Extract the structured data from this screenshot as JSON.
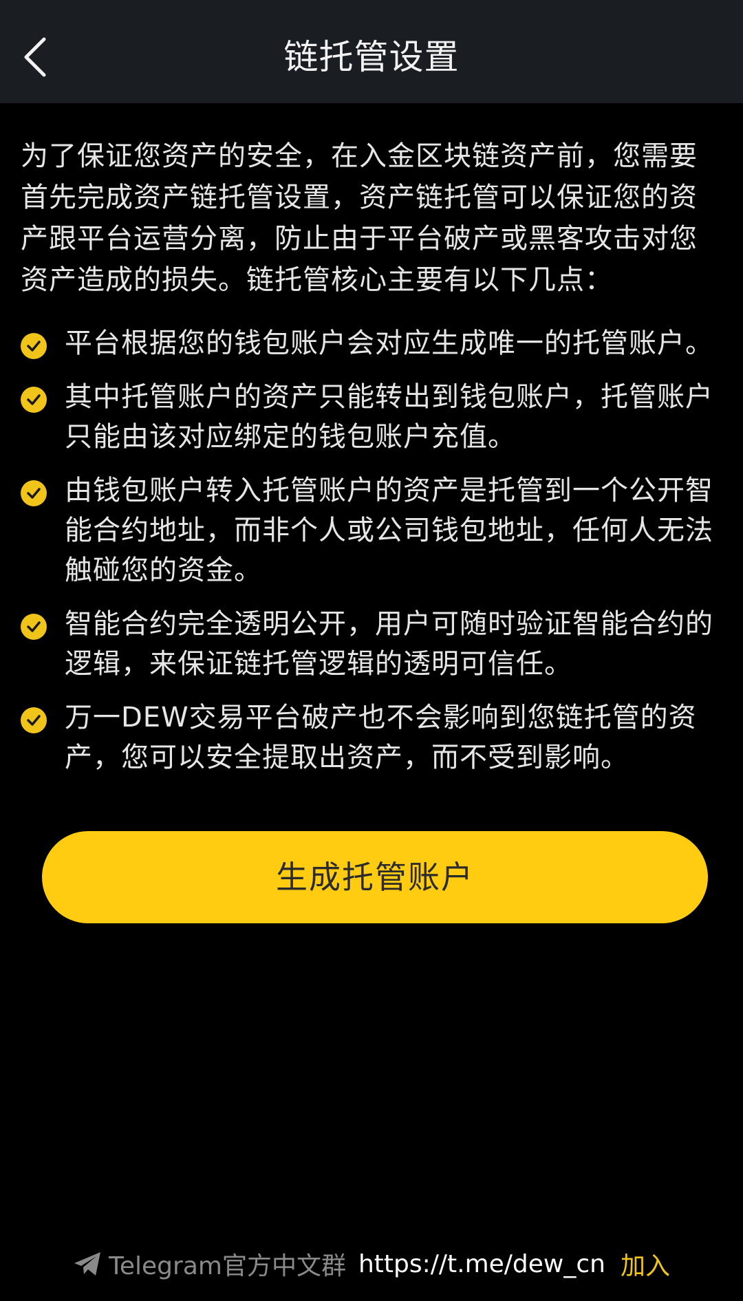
{
  "header": {
    "title": "链托管设置"
  },
  "intro": "为了保证您资产的安全，在入金区块链资产前，您需要首先完成资产链托管设置，资产链托管可以保证您的资产跟平台运营分离，防止由于平台破产或黑客攻击对您资产造成的损失。链托管核心主要有以下几点：",
  "points": [
    "平台根据您的钱包账户会对应生成唯一的托管账户。",
    "其中托管账户的资产只能转出到钱包账户，托管账户只能由该对应绑定的钱包账户充值。",
    "由钱包账户转入托管账户的资产是托管到一个公开智能合约地址，而非个人或公司钱包地址，任何人无法触碰您的资金。",
    "智能合约完全透明公开，用户可随时验证智能合约的逻辑，来保证链托管逻辑的透明可信任。",
    "万一DEW交易平台破产也不会影响到您链托管的资产，您可以安全提取出资产，而不受到影响。"
  ],
  "action": {
    "label": "生成托管账户"
  },
  "footer": {
    "label": "Telegram官方中文群",
    "link": "https://t.me/dew_cn",
    "join": "加入"
  },
  "colors": {
    "accent": "#ffcc12",
    "check": "#f0c419",
    "header_bg": "#1a1d21",
    "page_bg": "#000000"
  }
}
